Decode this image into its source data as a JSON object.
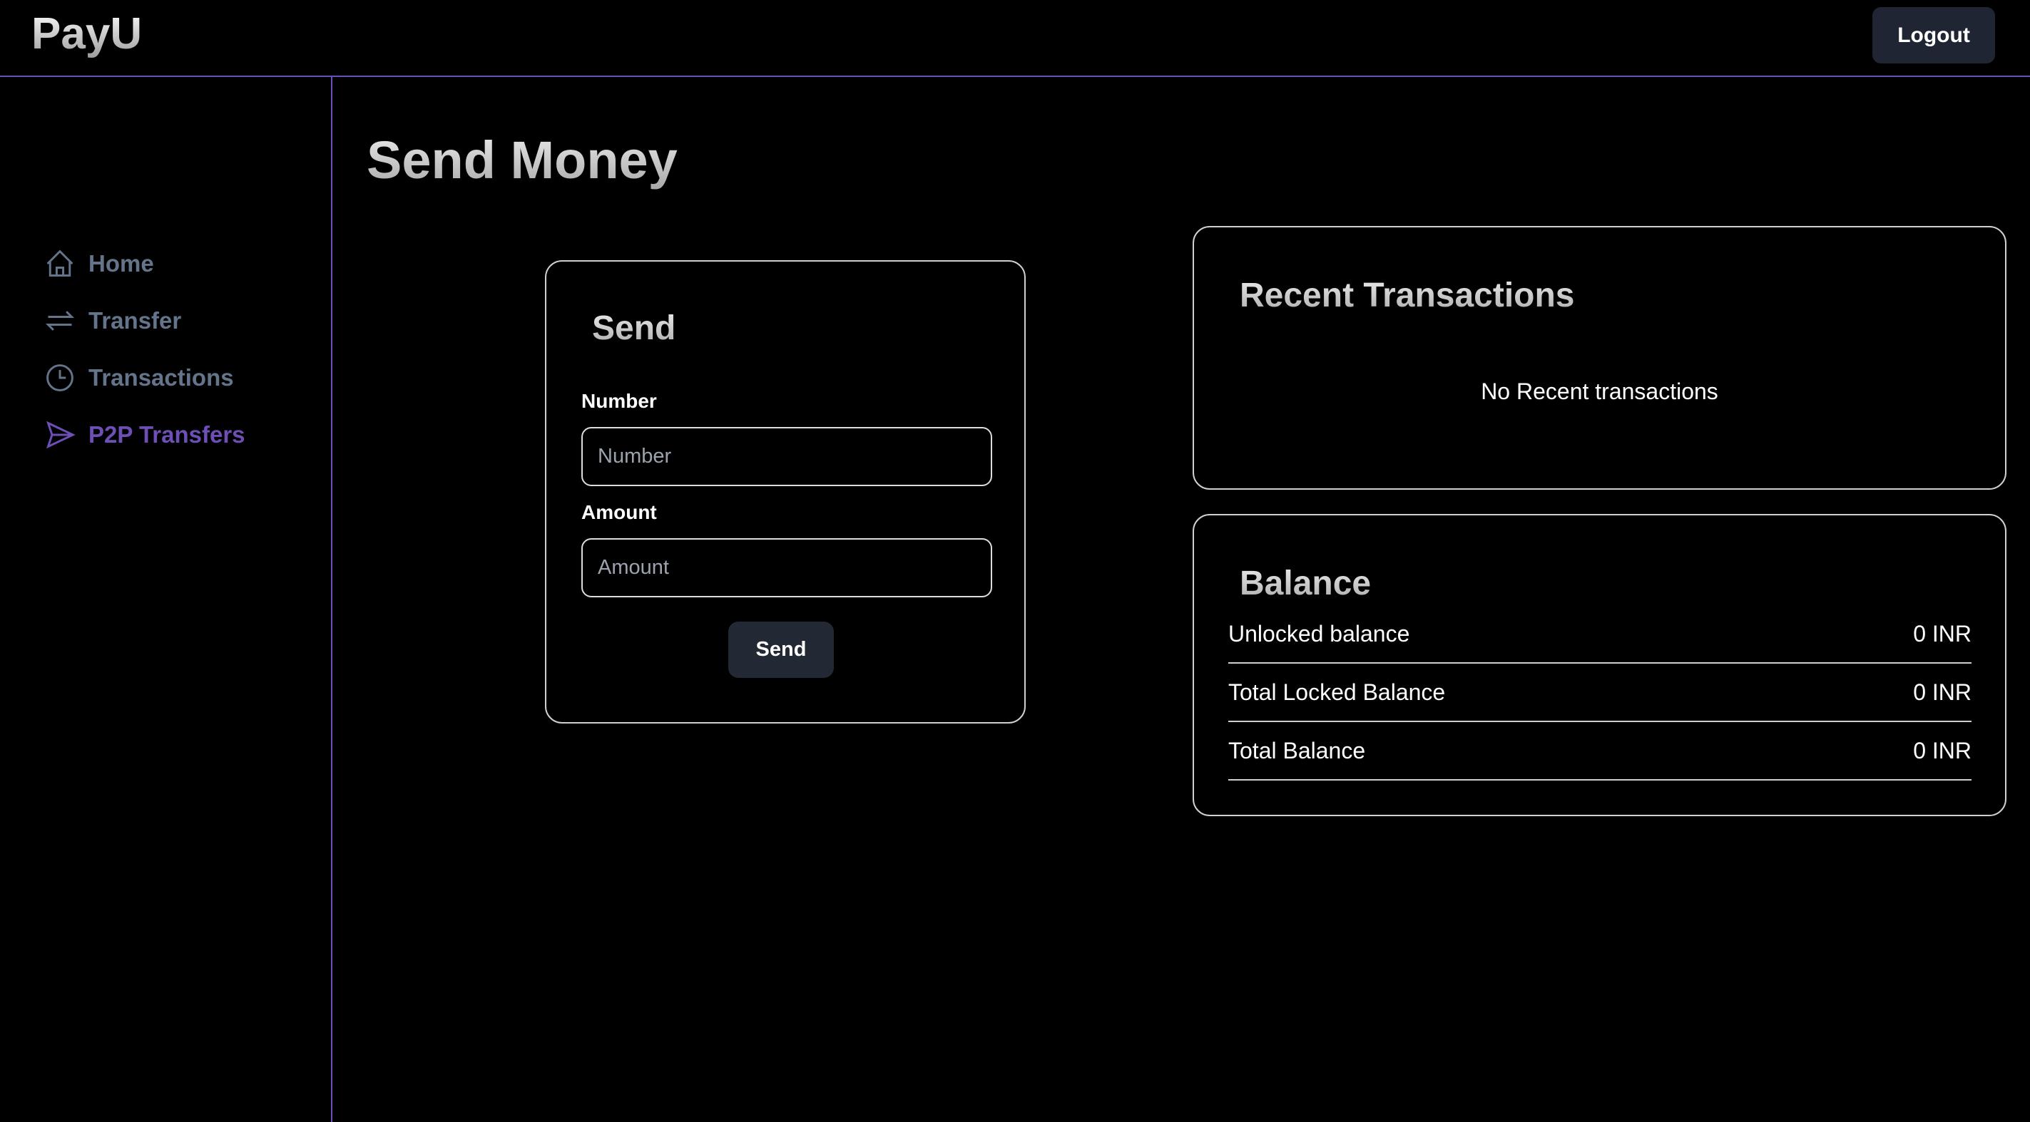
{
  "header": {
    "logo": "PayU",
    "logout_label": "Logout"
  },
  "sidebar": {
    "items": [
      {
        "label": "Home",
        "icon": "home-icon"
      },
      {
        "label": "Transfer",
        "icon": "arrows-right-left-icon"
      },
      {
        "label": "Transactions",
        "icon": "clock-icon"
      },
      {
        "label": "P2P Transfers",
        "icon": "paper-plane-icon",
        "active": true
      }
    ]
  },
  "colors": {
    "accent": "#6d4fb5",
    "nav": "#64748b",
    "button": "#1f2532"
  },
  "page": {
    "title": "Send Money"
  },
  "send_card": {
    "title": "Send",
    "number_label": "Number",
    "number_placeholder": "Number",
    "number_value": "",
    "amount_label": "Amount",
    "amount_placeholder": "Amount",
    "amount_value": "",
    "button": "Send"
  },
  "recent": {
    "title": "Recent Transactions",
    "empty": "No Recent transactions"
  },
  "balance": {
    "title": "Balance",
    "rows": [
      {
        "label": "Unlocked balance",
        "value": "0 INR"
      },
      {
        "label": "Total Locked Balance",
        "value": "0 INR"
      },
      {
        "label": "Total Balance",
        "value": "0 INR"
      }
    ]
  }
}
